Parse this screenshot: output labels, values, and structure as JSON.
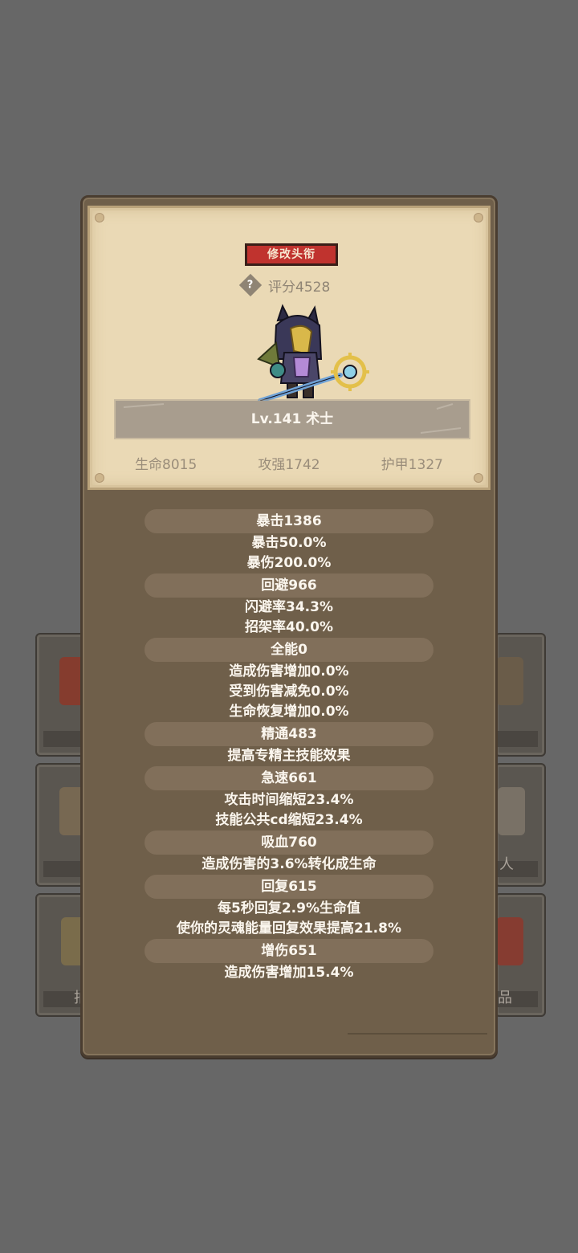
{
  "background": {
    "cards": [
      {
        "side": "left",
        "label": ""
      },
      {
        "side": "right",
        "label": ""
      },
      {
        "side": "left",
        "label": ""
      },
      {
        "side": "right",
        "label": "人"
      },
      {
        "side": "left",
        "label": "拍"
      },
      {
        "side": "right",
        "label": "品"
      }
    ]
  },
  "profile": {
    "edit_title_label": "修改头衔",
    "help_glyph": "?",
    "score_text": "评分4528",
    "level_text": "Lv.141 术士",
    "stats": [
      "生命8015",
      "攻强1742",
      "护甲1327"
    ]
  },
  "attributes": [
    {
      "name": "暴击1386",
      "details": [
        "暴击50.0%",
        "暴伤200.0%"
      ]
    },
    {
      "name": "回避966",
      "details": [
        "闪避率34.3%",
        "招架率40.0%"
      ]
    },
    {
      "name": "全能0",
      "details": [
        "造成伤害增加0.0%",
        "受到伤害减免0.0%",
        "生命恢复增加0.0%"
      ]
    },
    {
      "name": "精通483",
      "details": [
        "提高专精主技能效果"
      ]
    },
    {
      "name": "急速661",
      "details": [
        "攻击时间缩短23.4%",
        "技能公共cd缩短23.4%"
      ]
    },
    {
      "name": "吸血760",
      "details": [
        "造成伤害的3.6%转化成生命"
      ]
    },
    {
      "name": "回复615",
      "details": [
        "每5秒回复2.9%生命值",
        "使你的灵魂能量回复效果提高21.8%"
      ]
    },
    {
      "name": "增伤651",
      "details": [
        "造成伤害增加15.4%"
      ]
    }
  ],
  "colors": {
    "page_bg": "#676767",
    "modal_bg": "#6f5f4a",
    "parchment": "#ead9b5",
    "button_red": "#c0332e",
    "pill": "#816f5a",
    "text_light": "#fbf6ee",
    "text_muted": "#9a8d7a"
  }
}
